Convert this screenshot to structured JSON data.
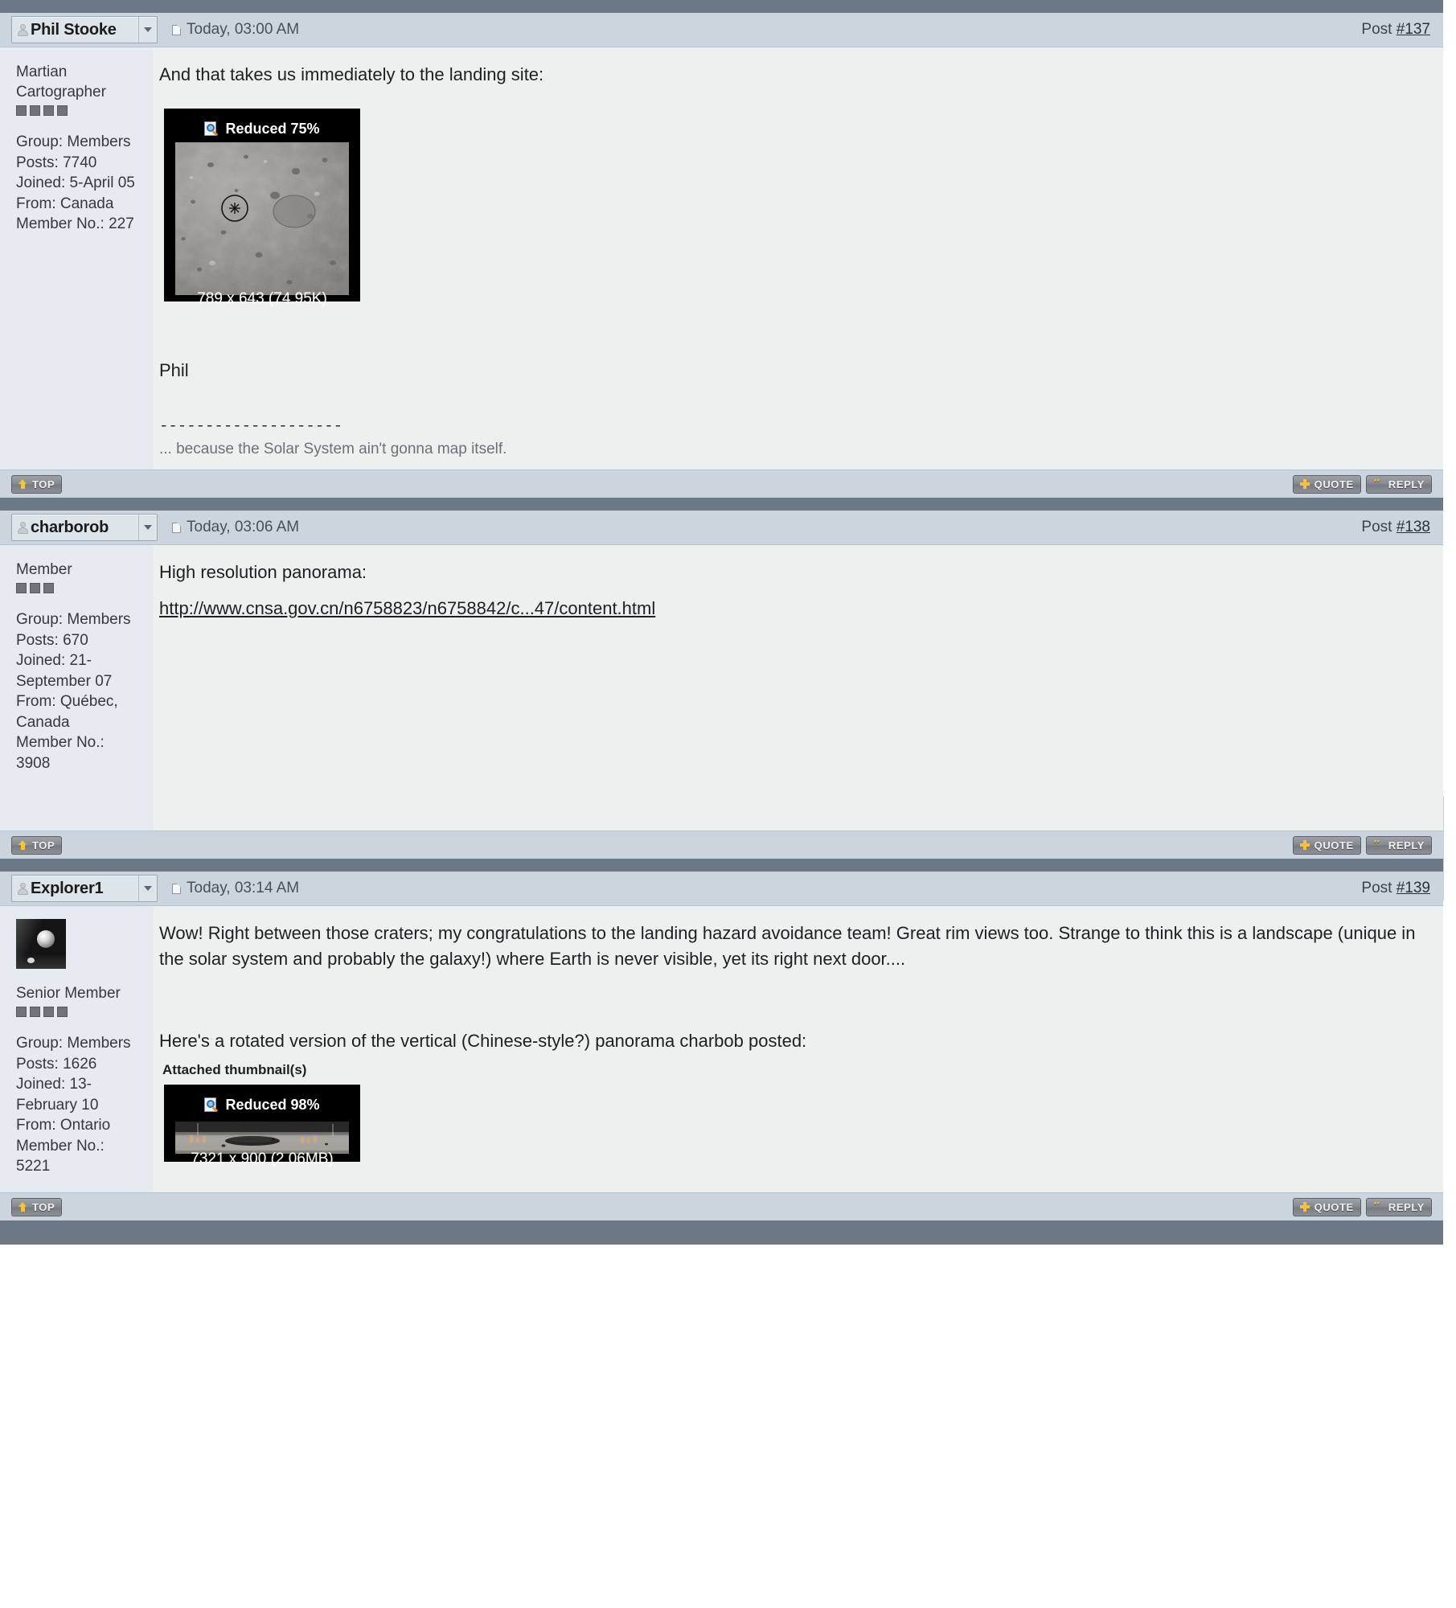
{
  "theme": {
    "separator_color": "#6c7886",
    "header_bg": "#ccd5de",
    "sidebar_bg": "#e6ebf1",
    "content_bg": "#eef0f0",
    "accent_icon_color": "#f2c240"
  },
  "buttons": {
    "top_label": "TOP",
    "quote_label": "QUOTE",
    "reply_label": "REPLY"
  },
  "posts": [
    {
      "username": "Phil Stooke",
      "date": "Today, 03:00 AM",
      "post_prefix": "Post ",
      "post_number": "#137",
      "sidebar": {
        "title": "Martian Cartographer",
        "pips": 4,
        "group": "Group: Members",
        "posts": "Posts: 7740",
        "joined": "Joined: 5-April 05",
        "from": "From: Canada",
        "member_no": "Member No.: 227",
        "has_avatar": false
      },
      "body": {
        "line1": "And that takes us immediately to the landing site:",
        "closing": "Phil",
        "sig_separator": "--------------------",
        "sig_text": "... because the Solar System ain't gonna map itself."
      },
      "attachment": {
        "reduced_label": "Reduced 75%",
        "dimensions": "789 x 643 (74.95K)",
        "kind": "lunar-surface-crater-field"
      }
    },
    {
      "username": "charborob",
      "date": "Today, 03:06 AM",
      "post_prefix": "Post ",
      "post_number": "#138",
      "sidebar": {
        "title": "Member",
        "pips": 3,
        "group": "Group: Members",
        "posts": "Posts: 670",
        "joined": "Joined: 21-September 07",
        "from": "From: Québec, Canada",
        "member_no": "Member No.: 3908",
        "has_avatar": false
      },
      "body": {
        "line1": "High resolution panorama:",
        "link": "http://www.cnsa.gov.cn/n6758823/n6758842/c...47/content.html"
      }
    },
    {
      "username": "Explorer1",
      "date": "Today, 03:14 AM",
      "post_prefix": "Post ",
      "post_number": "#139",
      "sidebar": {
        "title": "Senior Member",
        "pips": 4,
        "group": "Group: Members",
        "posts": "Posts: 1626",
        "joined": "Joined: 13-February 10",
        "from": "From: Ontario",
        "member_no": "Member No.: 5221",
        "has_avatar": true
      },
      "body": {
        "line1": "Wow! Right between those craters; my congratulations to the landing hazard avoidance team! Great rim views too. Strange to think this is a landscape (unique in the solar system and probably the galaxy!) where Earth is never visible, yet its right next door....",
        "line2": "Here's a rotated version of the vertical (Chinese-style?) panorama charbob posted:",
        "attached_label": "Attached thumbnail(s)"
      },
      "attachment": {
        "reduced_label": "Reduced 98%",
        "dimensions": "7321 x 900 (2.06MB)",
        "kind": "lunar-panorama-strip"
      }
    }
  ]
}
